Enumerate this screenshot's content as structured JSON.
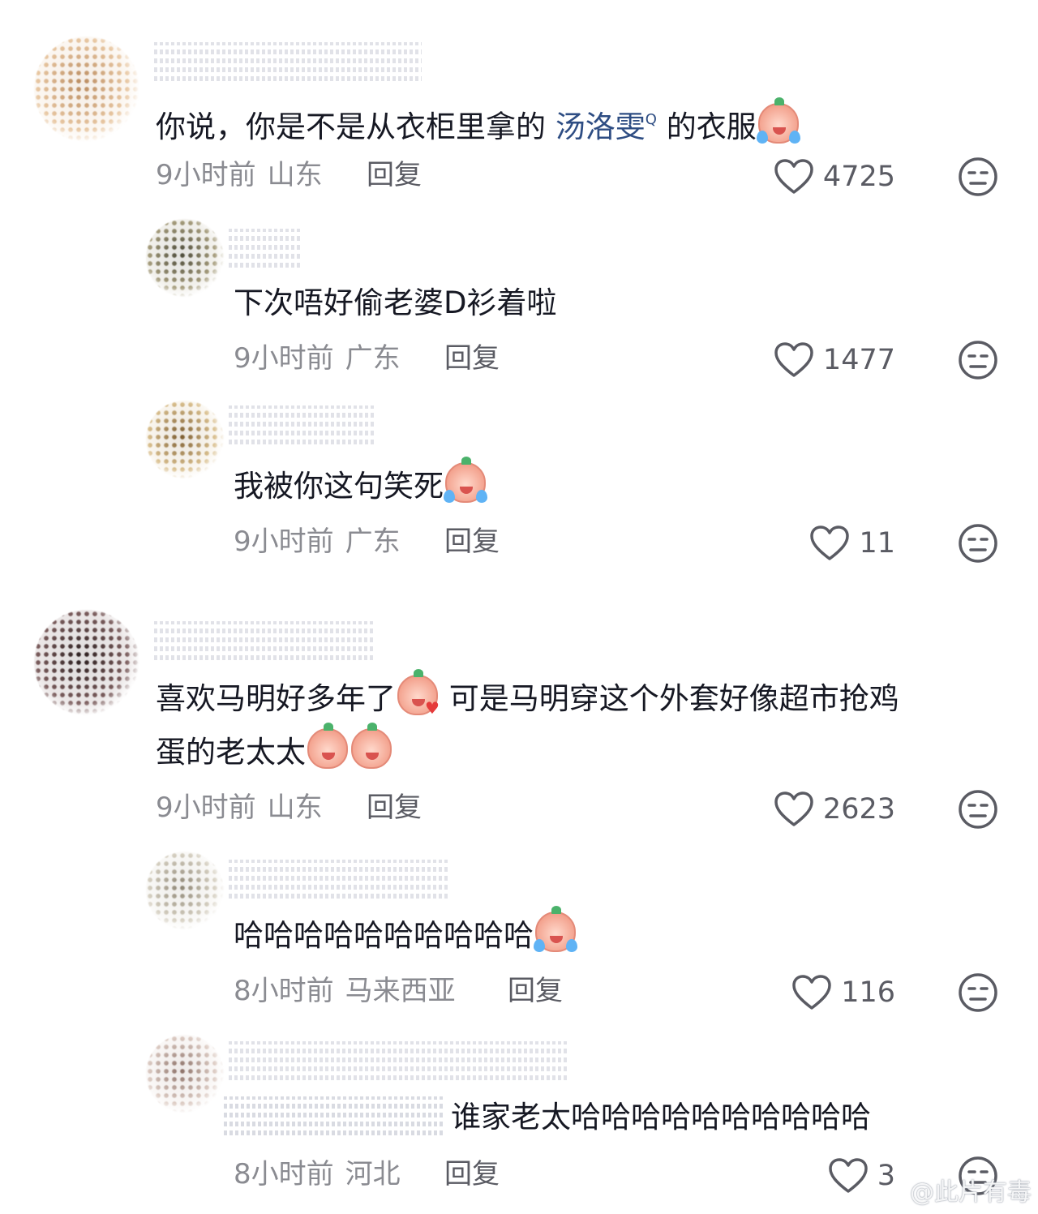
{
  "comments": [
    {
      "text_before": "你说，你是不是从衣柜里拿的 ",
      "mention": "汤洛雯",
      "text_after": " 的衣服",
      "time": "9小时前",
      "location": "山东",
      "reply": "回复",
      "likes": "4725"
    },
    {
      "text": "下次唔好偷老婆D衫着啦",
      "time": "9小时前",
      "location": "广东",
      "reply": "回复",
      "likes": "1477"
    },
    {
      "text": "我被你这句笑死",
      "time": "9小时前",
      "location": "广东",
      "reply": "回复",
      "likes": "11"
    },
    {
      "line1_a": "喜欢马明好多年了",
      "line1_b": " 可是马明穿这个外套好像超市抢鸡",
      "line2": "蛋的老太太",
      "time": "9小时前",
      "location": "山东",
      "reply": "回复",
      "likes": "2623"
    },
    {
      "text": "哈哈哈哈哈哈哈哈哈哈",
      "time": "8小时前",
      "location": "马来西亚",
      "reply": "回复",
      "likes": "116"
    },
    {
      "text": "谁家老太哈哈哈哈哈哈哈哈哈哈",
      "time": "8小时前",
      "location": "河北",
      "reply": "回复",
      "likes": "3"
    }
  ],
  "mention_search_mark": "Q",
  "watermark": "@此片有毒",
  "icons": {
    "like": "heart-outline-icon",
    "dislike": "dislike-face-icon",
    "emoji_laugh_cry": "laugh-cry-emoji-icon",
    "emoji_kiss_heart": "kiss-heart-emoji-icon",
    "emoji_cover_mouth": "cover-mouth-emoji-icon"
  },
  "colors": {
    "text": "#161823",
    "meta": "#8a8b91",
    "mention": "#2e4d83"
  }
}
